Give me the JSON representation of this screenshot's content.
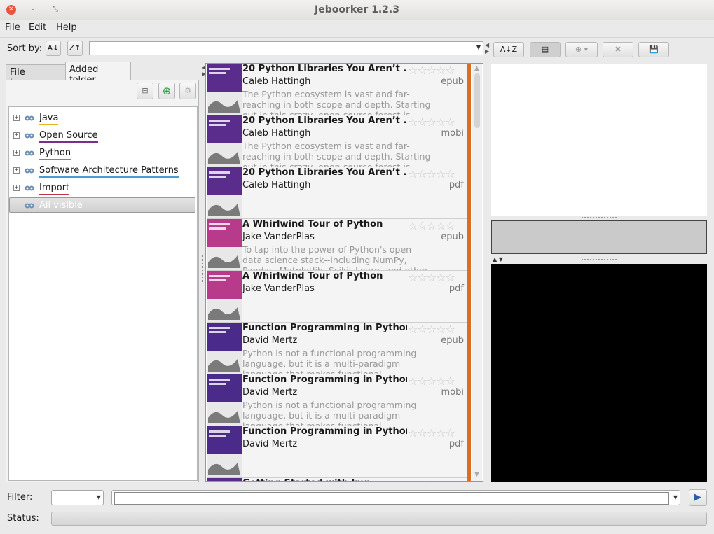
{
  "window": {
    "title": "Jeboorker 1.2.3"
  },
  "menu": {
    "file": "File",
    "edit": "Edit",
    "help": "Help"
  },
  "sort": {
    "label": "Sort by:",
    "value": ""
  },
  "tabs": {
    "file_browser": "File browser",
    "added_folder": "Added folder"
  },
  "tree": {
    "items": [
      {
        "label": "Java",
        "color": "#e4b820"
      },
      {
        "label": "Open Source",
        "color": "#7a2c8f"
      },
      {
        "label": "Python",
        "color": "#e06a1a"
      },
      {
        "label": "Software Architecture Patterns",
        "color": "#4a9bd6"
      },
      {
        "label": "Import",
        "color": "#c0354a"
      },
      {
        "label": "All visible",
        "color": ""
      }
    ]
  },
  "books": [
    {
      "title": "20 Python Libraries You Aren’t ...",
      "author": "Caleb Hattingh",
      "format": "epub",
      "description": "The Python ecosystem is vast and far-reaching in both scope and depth. Starting out in this crazy, open-source forest is daunting, and even with",
      "cover_color": "#5a2c8c"
    },
    {
      "title": "20 Python Libraries You Aren’t ...",
      "author": "Caleb Hattingh",
      "format": "mobi",
      "description": "The Python ecosystem is vast and far-reaching in both scope and depth. Starting out in this crazy, open-source forest is daunting, and even with",
      "cover_color": "#5a2c8c"
    },
    {
      "title": "20 Python Libraries You Aren’t ...",
      "author": "Caleb Hattingh",
      "format": "pdf",
      "description": "",
      "cover_color": "#5a2c8c"
    },
    {
      "title": "A Whirlwind Tour of Python",
      "author": "Jake VanderPlas",
      "format": "epub",
      "description": "To tap into the power of Python's open data science stack--including NumPy, Pandas, Matplotlib, Scikit-Learn, and other tools--you first",
      "cover_color": "#b83a8a"
    },
    {
      "title": "A Whirlwind Tour of Python",
      "author": "Jake VanderPlas",
      "format": "pdf",
      "description": "",
      "cover_color": "#b83a8a"
    },
    {
      "title": "Function Programming in Python",
      "author": "David Mertz",
      "format": "epub",
      "description": "Python is not a functional programming language, but it is a multi-paradigm language that makes functional programming easy to perform, and easy",
      "cover_color": "#4b2b8a"
    },
    {
      "title": "Function Programming in Python",
      "author": "David Mertz",
      "format": "mobi",
      "description": "Python is not a functional programming language, but it is a multi-paradigm language that makes functional programming easy to perform, and easy",
      "cover_color": "#4b2b8a"
    },
    {
      "title": "Function Programming in Python",
      "author": "David Mertz",
      "format": "pdf",
      "description": "",
      "cover_color": "#4b2b8a"
    },
    {
      "title": "Getting Started with Imp...",
      "author": "",
      "format": "",
      "description": "",
      "cover_color": "#5a2c8c"
    }
  ],
  "filter": {
    "label": "Filter:",
    "field_value": "",
    "input_value": ""
  },
  "status": {
    "label": "Status:",
    "text": ""
  },
  "stars": "☆☆☆☆☆"
}
